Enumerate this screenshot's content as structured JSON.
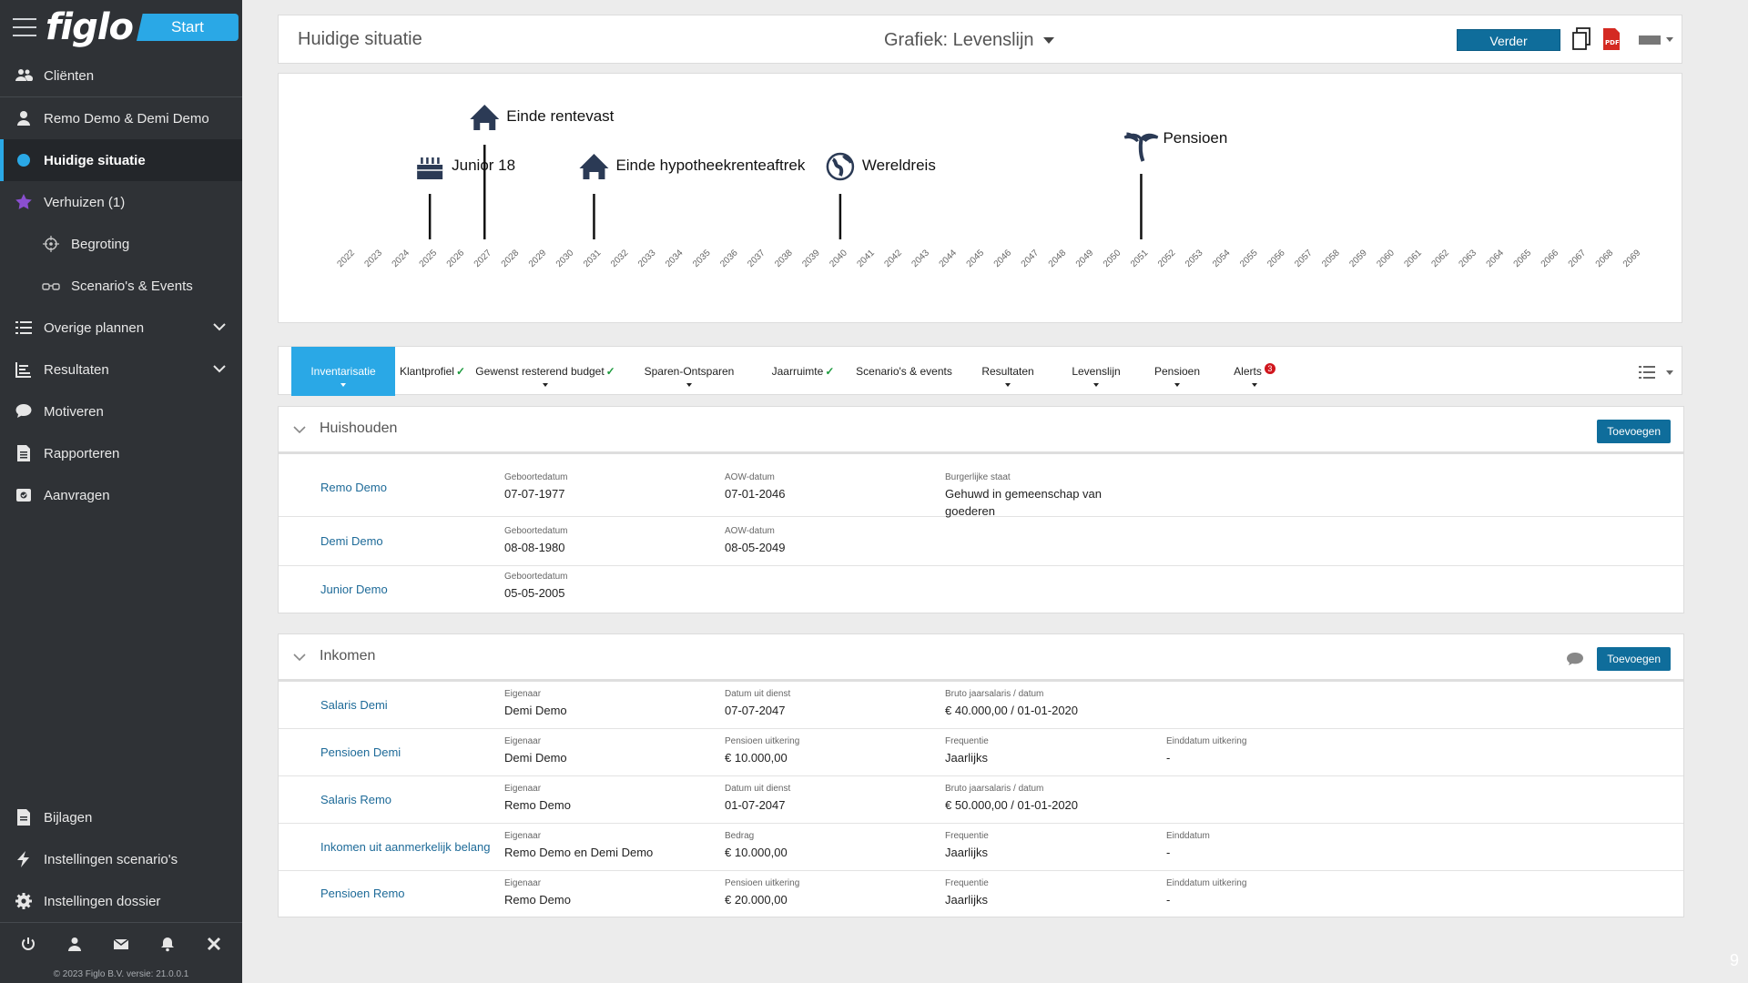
{
  "sidebar": {
    "logo": "figlo",
    "start_label": "Start",
    "items": [
      {
        "label": "Cliënten",
        "icon": "users-icon"
      },
      {
        "label": "Remo Demo & Demi Demo",
        "icon": "user-icon"
      },
      {
        "label": "Huidige situatie",
        "icon": "dot-icon",
        "active": true
      },
      {
        "label": "Verhuizen (1)",
        "icon": "star-icon"
      },
      {
        "label": "Begroting",
        "icon": "target-icon",
        "sub": true
      },
      {
        "label": "Scenario's & Events",
        "icon": "glasses-icon",
        "sub": true
      },
      {
        "label": "Overige plannen",
        "icon": "list-icon",
        "expandable": true
      },
      {
        "label": "Resultaten",
        "icon": "chart-icon",
        "expandable": true
      },
      {
        "label": "Motiveren",
        "icon": "chat-icon"
      },
      {
        "label": "Rapporteren",
        "icon": "document-icon"
      },
      {
        "label": "Aanvragen",
        "icon": "send-icon"
      }
    ],
    "bottom_items": [
      {
        "label": "Bijlagen",
        "icon": "file-icon"
      },
      {
        "label": "Instellingen scenario's",
        "icon": "bolt-icon"
      },
      {
        "label": "Instellingen dossier",
        "icon": "gear-icon"
      }
    ],
    "copyright": "© 2023 Figlo B.V. versie: 21.0.0.1"
  },
  "header": {
    "title": "Huidige situatie",
    "chart_select_label": "Grafiek:",
    "chart_select_value": "Levenslijn",
    "verder_label": "Verder"
  },
  "timeline": {
    "years": [
      "2022",
      "2023",
      "2024",
      "2025",
      "2026",
      "2027",
      "2028",
      "2029",
      "2030",
      "2031",
      "2032",
      "2033",
      "2034",
      "2035",
      "2036",
      "2037",
      "2038",
      "2039",
      "2040",
      "2041",
      "2042",
      "2043",
      "2044",
      "2045",
      "2046",
      "2047",
      "2048",
      "2049",
      "2050",
      "2051",
      "2052",
      "2053",
      "2054",
      "2055",
      "2056",
      "2057",
      "2058",
      "2059",
      "2060",
      "2061",
      "2062",
      "2063",
      "2064",
      "2065",
      "2066",
      "2067",
      "2068",
      "2069"
    ],
    "events": [
      {
        "label": "Junior 18",
        "year": 2025,
        "icon": "cake-icon",
        "level": "low"
      },
      {
        "label": "Einde rentevast",
        "year": 2027,
        "icon": "house-icon",
        "level": "high"
      },
      {
        "label": "Einde hypotheekrenteaftrek",
        "year": 2031,
        "icon": "house-icon",
        "level": "low"
      },
      {
        "label": "Wereldreis",
        "year": 2040,
        "icon": "globe-icon",
        "level": "low"
      },
      {
        "label": "Pensioen",
        "year": 2051,
        "icon": "palm-icon",
        "level": "mid"
      }
    ]
  },
  "tabs": [
    {
      "label": "Inventarisatie",
      "active": true,
      "dropdown": true
    },
    {
      "label": "Klantprofiel",
      "check": "✓"
    },
    {
      "label": "Gewenst resterend budget",
      "check": "✓",
      "dropdown": true
    },
    {
      "label": "Sparen-Ontsparen",
      "dropdown": true
    },
    {
      "label": "Jaarruimte",
      "check": "✓"
    },
    {
      "label": "Scenario's & events"
    },
    {
      "label": "Resultaten",
      "dropdown": true
    },
    {
      "label": "Levenslijn",
      "dropdown": true
    },
    {
      "label": "Pensioen",
      "dropdown": true
    },
    {
      "label": "Alerts",
      "badge": "3",
      "dropdown": true
    }
  ],
  "huishouden": {
    "title": "Huishouden",
    "add_label": "Toevoegen",
    "rows": [
      {
        "name": "Remo Demo",
        "f1_label": "Geboortedatum",
        "f1": "07-07-1977",
        "f2_label": "AOW-datum",
        "f2": "07-01-2046",
        "f3_label": "Burgerlijke staat",
        "f3": "Gehuwd in gemeenschap van goederen"
      },
      {
        "name": "Demi Demo",
        "f1_label": "Geboortedatum",
        "f1": "08-08-1980",
        "f2_label": "AOW-datum",
        "f2": "08-05-2049"
      },
      {
        "name": "Junior Demo",
        "f1_label": "Geboortedatum",
        "f1": "05-05-2005"
      }
    ]
  },
  "inkomen": {
    "title": "Inkomen",
    "add_label": "Toevoegen",
    "rows": [
      {
        "name": "Salaris Demi",
        "f1_label": "Eigenaar",
        "f1": "Demi Demo",
        "f2_label": "Datum uit dienst",
        "f2": "07-07-2047",
        "f3_label": "Bruto jaarsalaris / datum",
        "f3": "€ 40.000,00 / 01-01-2020"
      },
      {
        "name": "Pensioen Demi",
        "f1_label": "Eigenaar",
        "f1": "Demi Demo",
        "f2_label": "Pensioen uitkering",
        "f2": "€ 10.000,00",
        "f3_label": "Frequentie",
        "f3": "Jaarlijks",
        "f4_label": "Einddatum uitkering",
        "f4": "-"
      },
      {
        "name": "Salaris Remo",
        "f1_label": "Eigenaar",
        "f1": "Remo Demo",
        "f2_label": "Datum uit dienst",
        "f2": "01-07-2047",
        "f3_label": "Bruto jaarsalaris / datum",
        "f3": "€ 50.000,00 / 01-01-2020"
      },
      {
        "name": "Inkomen uit aanmerkelijk belang",
        "f1_label": "Eigenaar",
        "f1": "Remo Demo en Demi Demo",
        "f2_label": "Bedrag",
        "f2": "€ 10.000,00",
        "f3_label": "Frequentie",
        "f3": "Jaarlijks",
        "f4_label": "Einddatum",
        "f4": "-"
      },
      {
        "name": "Pensioen Remo",
        "f1_label": "Eigenaar",
        "f1": "Remo Demo",
        "f2_label": "Pensioen uitkering",
        "f2": "€ 20.000,00",
        "f3_label": "Frequentie",
        "f3": "Jaarlijks",
        "f4_label": "Einddatum uitkering",
        "f4": "-"
      }
    ]
  },
  "page_number": "9",
  "colors": {
    "accent": "#2aa8e6",
    "button": "#0f6d9b",
    "sidebar": "#2f3236",
    "link": "#1d6a98"
  }
}
